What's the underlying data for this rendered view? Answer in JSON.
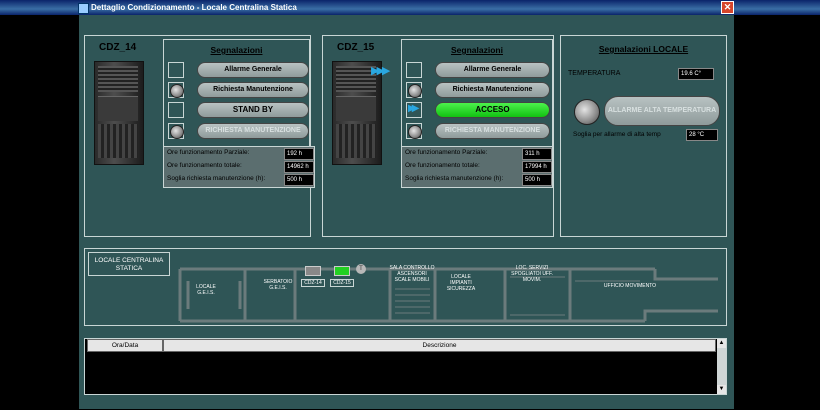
{
  "window": {
    "title": "Dettaglio Condizionamento - Locale Centralina Statica",
    "close_glyph": "✕"
  },
  "units": [
    {
      "name": "CDZ_14",
      "signals_title": "Segnalazioni",
      "buttons": [
        "Allarme Generale",
        "Richiesta Manutenzione",
        "STAND BY",
        "RICHIESTA MANUTENZIONE"
      ],
      "info": [
        {
          "label": "Ore funzionamento Parziale:",
          "value": "192 h"
        },
        {
          "label": "Ore funzionamento totale:",
          "value": "14962 h"
        },
        {
          "label": "Soglia richiesta manutenzione (h):",
          "value": "500 h"
        }
      ]
    },
    {
      "name": "CDZ_15",
      "signals_title": "Segnalazioni",
      "buttons": [
        "Allarme Generale",
        "Richiesta Manutenzione",
        "ACCESO",
        "RICHIESTA MANUTENZIONE"
      ],
      "info": [
        {
          "label": "Ore funzionamento Parziale:",
          "value": "311 h"
        },
        {
          "label": "Ore funzionamento totale:",
          "value": "17994 h"
        },
        {
          "label": "Soglia richiesta manutenzione (h):",
          "value": "500 h"
        }
      ]
    }
  ],
  "local": {
    "title": "Segnalazioni LOCALE",
    "temp_label": "TEMPERATURA",
    "temp_value": "19.6 C°",
    "alarm_button": "ALLARME ALTA TEMPERATURA",
    "threshold_label": "Soglia per allarme di alta temp",
    "threshold_value": "28 °C"
  },
  "map": {
    "title": "LOCALE CENTRALINA STATICA",
    "rooms": [
      "LOCALE G.E.I.S.",
      "SERBATOIO G.E.I.S.",
      "CDZ-14",
      "CDZ-15",
      "T",
      "SALA CONTROLLO ASCENSORI SCALE MOBILI",
      "LOCALE IMPIANTI SICUREZZA",
      "LOC. SERVIZI SPOGLIATOI UFF. MOVIM.",
      "UFFICIO MOVIMENTO"
    ]
  },
  "log": {
    "columns": [
      "Ora/Data",
      "Descrizione"
    ],
    "scroll_up": "▲",
    "scroll_down": "▼"
  },
  "colors": {
    "background": "#2f5556",
    "accent_on": "#22d022",
    "fan_blue": "#2aa7e0"
  }
}
